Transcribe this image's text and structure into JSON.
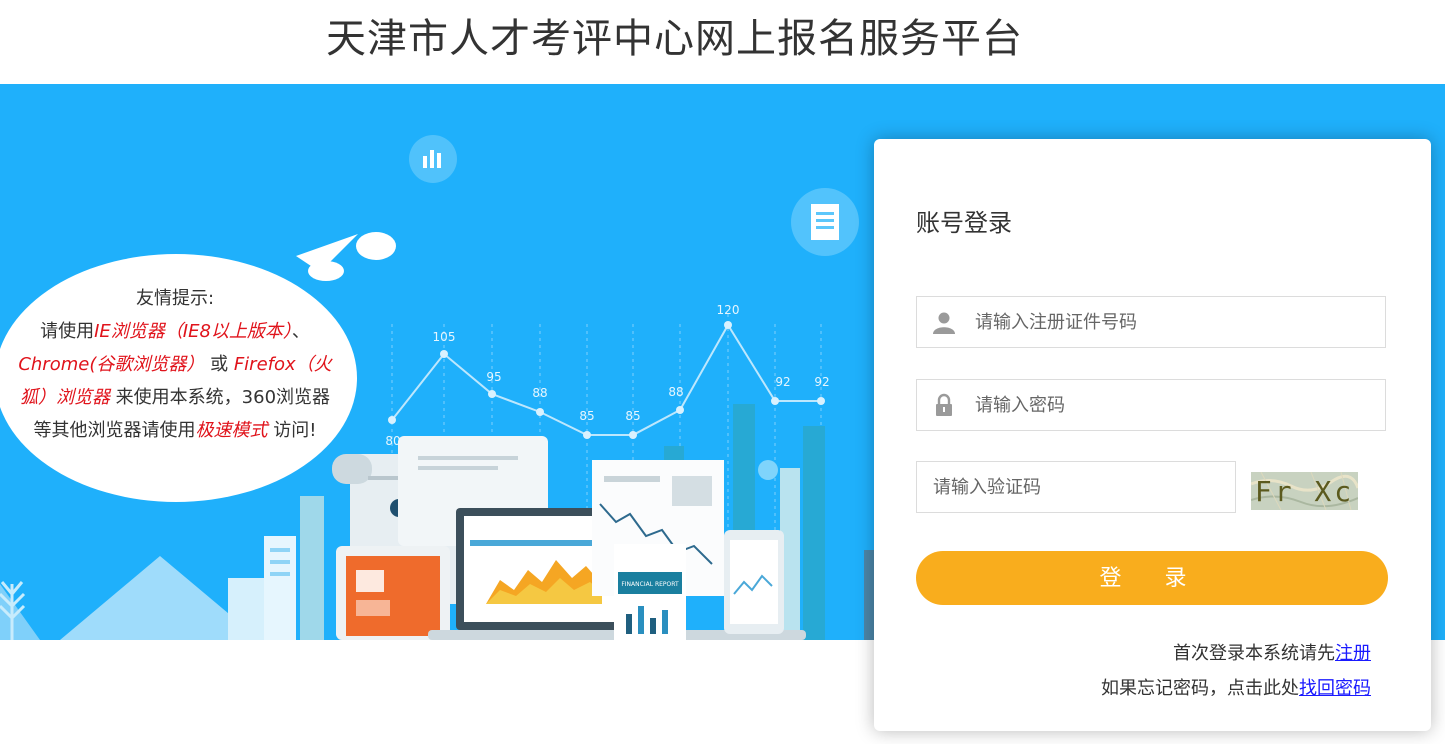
{
  "header": {
    "title": "天津市人才考评中心网上报名服务平台"
  },
  "tip": {
    "line1": "友情提示:",
    "line2_prefix": "请使用",
    "line2_red": "IE浏览器（IE8以上版本）",
    "line2_suffix": "、",
    "line3_red1": "Chrome(谷歌浏览器）",
    "line3_mid": "或 ",
    "line3_red2": "Firefox（火",
    "line4_red": "狐）浏览器",
    "line4_suffix": " 来使用本系统，360浏览器",
    "line5_prefix": "等其他浏览器请使用",
    "line5_red": "极速模式",
    "line5_suffix": " 访问!"
  },
  "banner_chart": {
    "labels": [
      "80",
      "105",
      "95",
      "88",
      "85",
      "85",
      "88",
      "120",
      "92",
      "92"
    ],
    "report_label": "FINANCIAL REPORT"
  },
  "login": {
    "title": "账号登录",
    "id_placeholder": "请输入注册证件号码",
    "password_placeholder": "请输入密码",
    "captcha_placeholder": "请输入验证码",
    "captcha_text": "Fr Xc",
    "submit_label": "登 录",
    "register_hint": "首次登录本系统请先",
    "register_link": "注册",
    "forgot_hint": "如果忘记密码，点击此处",
    "forgot_link": "找回密码"
  },
  "colors": {
    "banner_bg": "#1fb0fb",
    "button": "#f9ad1d",
    "tip_red": "#e0131b",
    "link": "#1a1aff"
  },
  "icons": [
    "user-icon",
    "lock-icon",
    "bar-chart-icon",
    "document-icon",
    "paper-plane-icon"
  ]
}
